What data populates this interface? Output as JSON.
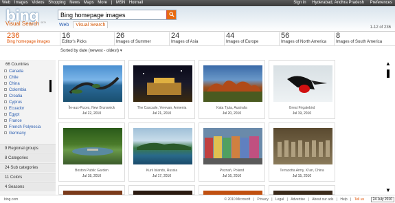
{
  "topbar": {
    "nav": [
      "Web",
      "Images",
      "Videos",
      "Shopping",
      "News",
      "Maps",
      "More",
      "|",
      "MSN",
      "Hotmail"
    ],
    "sign_in": "Sign in",
    "location": "Hyderabad, Andhra Pradesh",
    "preferences": "Preferences"
  },
  "header": {
    "logo": "bing",
    "subtitle": "Visual Search",
    "beta": "BETA",
    "search_value": "Bing homepage images",
    "scope_web": "Web",
    "scope_visual": "Visual Search",
    "result_count": "1-12 of 236"
  },
  "categories": [
    {
      "count": "236",
      "label": "Bing homepage images"
    },
    {
      "count": "16",
      "label": "Editor's Picks"
    },
    {
      "count": "26",
      "label": "Images of Summer"
    },
    {
      "count": "24",
      "label": "Images of Asia"
    },
    {
      "count": "44",
      "label": "Images of Europe"
    },
    {
      "count": "56",
      "label": "Images of North America"
    },
    {
      "count": "8",
      "label": "Images of South America"
    }
  ],
  "sort": "Sorted by date (newest - oldest) ▾",
  "sidebar": {
    "heading": "66 Countries",
    "countries": [
      "Canada",
      "Chile",
      "China",
      "Colombia",
      "Croatia",
      "Cyprus",
      "Ecuador",
      "Egypt",
      "France",
      "French Polynesia",
      "Germany"
    ],
    "groups": [
      "9 Regional groups",
      "8 Categories",
      "24 Sub categories",
      "11 Colors",
      "4 Seasons"
    ]
  },
  "cards": [
    {
      "caption": "Île-aux-Puces, New Brunswick",
      "date": "Jul 22, 2010"
    },
    {
      "caption": "The Cascade, Yerevan, Armenia",
      "date": "Jul 21, 2010"
    },
    {
      "caption": "Kata Tjuta, Australia",
      "date": "Jul 20, 2010"
    },
    {
      "caption": "Great Frigatebird",
      "date": "Jul 19, 2010"
    },
    {
      "caption": "Boston Public Garden",
      "date": "Jul 18, 2010"
    },
    {
      "caption": "Kurii Islands, Russia",
      "date": "Jul 17, 2010"
    },
    {
      "caption": "Poznań, Poland",
      "date": "Jul 16, 2010"
    },
    {
      "caption": "Terracotta Army, Xi'an, China",
      "date": "Jul 15, 2010"
    }
  ],
  "footer": {
    "brand": "bing.com",
    "links": [
      "© 2010 Microsoft",
      "|",
      "Privacy",
      "|",
      "Legal",
      "|",
      "Advertise",
      "|",
      "About our ads",
      "|",
      "Help",
      "|"
    ],
    "tellus": "Tell us",
    "stamp": "24 July 2010"
  },
  "colors": {
    "accent": "#e05000",
    "link": "#2a5db0",
    "search_button": "#e86a10"
  }
}
